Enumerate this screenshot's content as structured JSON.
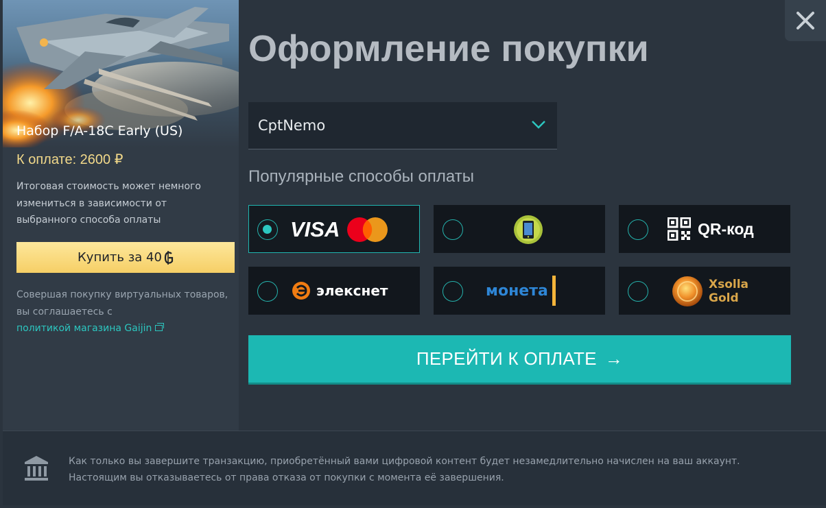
{
  "dialog": {
    "title": "Оформление покупки",
    "close_label": "✕"
  },
  "product": {
    "name": "Набор F/A-18C Early (US)",
    "price_text": "К оплате: 2600 ₽",
    "price_note": "Итоговая стоимость может немного измениться в зависимости от выбранного способа оплаты",
    "buy_label": "Купить за 40",
    "buy_currency_icon": "golden-eagle-icon",
    "agree_text": "Совершая покупку виртуальных товаров, вы соглашаетесь с",
    "policy_link": "политикой магазина Gaijin"
  },
  "account": {
    "selected": "CptNemo"
  },
  "payment": {
    "label": "Популярные способы оплаты",
    "methods": [
      {
        "id": "card",
        "label": "VISA",
        "selected": true
      },
      {
        "id": "mobile",
        "label": "",
        "selected": false
      },
      {
        "id": "qr",
        "label": "QR-код",
        "selected": false
      },
      {
        "id": "eleksnet",
        "label": "элекснет",
        "selected": false
      },
      {
        "id": "moneta",
        "label": "монета",
        "selected": false
      },
      {
        "id": "xsolla",
        "label": "Xsolla Gold",
        "label_line1": "Xsolla",
        "label_line2": "Gold",
        "selected": false
      }
    ],
    "proceed_label": "ПЕРЕЙТИ К ОПЛАТЕ",
    "proceed_arrow": "→"
  },
  "footer": {
    "icon": "bank-icon",
    "line1": "Как только вы завершите транзакцию, приобретённый вами цифровой контент будет незамедлительно начислен на ваш аккаунт.",
    "line2": "Настоящим вы отказываетесь от права отказа от покупки с момента её завершения."
  },
  "colors": {
    "accent": "#1cb8b3",
    "buy_button": "#f6cf66",
    "price": "#f2d98a",
    "background": "#2b343e"
  }
}
